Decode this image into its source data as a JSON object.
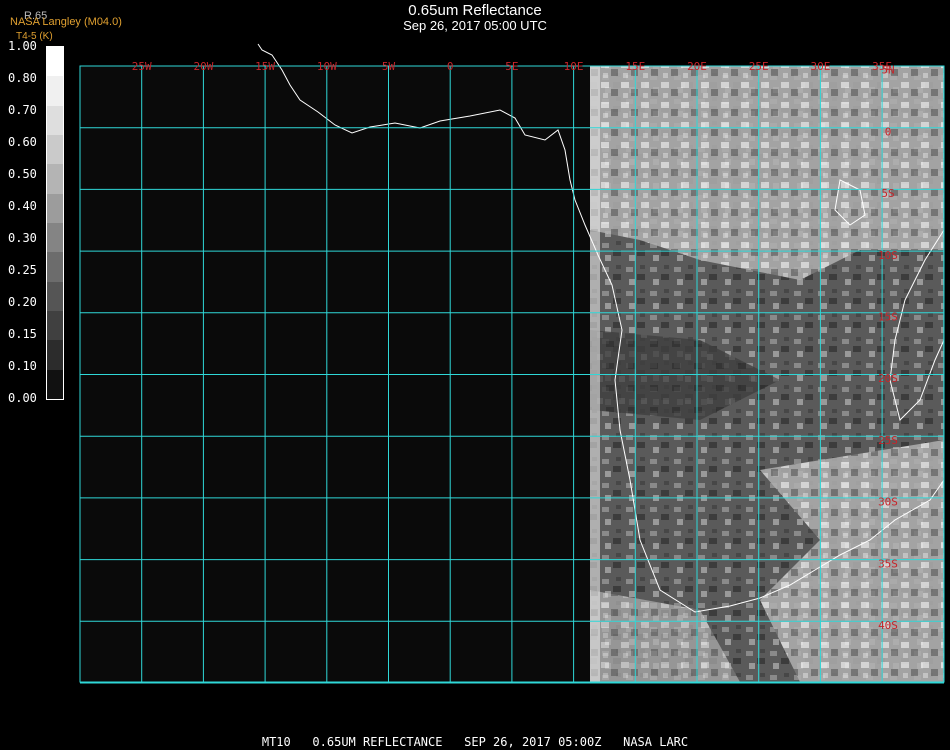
{
  "header": {
    "title": "0.65um Reflectance",
    "subtitle": "Sep 26, 2017 05:00 UTC"
  },
  "tags": {
    "source": "NASA Langley (M04.0)",
    "var": "T4-5 (K)",
    "channel": "R.65"
  },
  "colorbar": {
    "labels": [
      "1.00",
      "0.80",
      "0.70",
      "0.60",
      "0.50",
      "0.40",
      "0.30",
      "0.25",
      "0.20",
      "0.15",
      "0.10",
      "0.00"
    ],
    "colors": [
      "#ffffff",
      "#f0f0f0",
      "#dedede",
      "#cacaca",
      "#b4b4b4",
      "#9c9c9c",
      "#848484",
      "#6c6c6c",
      "#555555",
      "#404040",
      "#2c2c2c",
      "#111111"
    ]
  },
  "grid": {
    "lon_labels": [
      "25W",
      "20W",
      "15W",
      "10W",
      "5W",
      "0",
      "5E",
      "10E",
      "15E",
      "20E",
      "25E",
      "30E",
      "35E"
    ],
    "lat_labels": [
      "5N",
      "0",
      "5S",
      "10S",
      "15S",
      "20S",
      "25S",
      "30S",
      "35S",
      "40S"
    ]
  },
  "footer": "MT10   0.65UM REFLECTANCE   SEP 26, 2017 05:00Z   NASA LARC",
  "colors": {
    "grid": "#2fd8d8",
    "coast": "#ffffff",
    "label": "#c8242a",
    "tag": "#e0a030"
  }
}
